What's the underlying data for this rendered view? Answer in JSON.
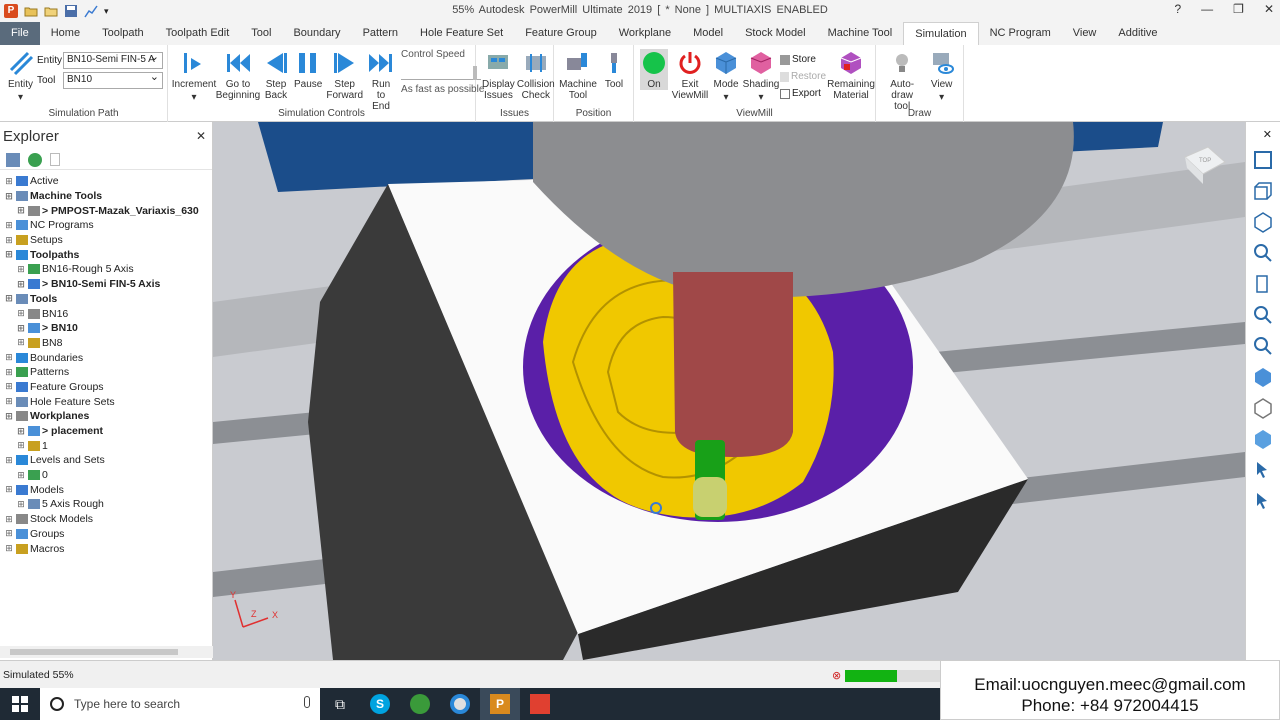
{
  "title": "55% Autodesk PowerMill Ultimate 2019    [ * None ]    MULTIAXIS ENABLED",
  "tabs": [
    "File",
    "Home",
    "Toolpath",
    "Toolpath Edit",
    "Tool",
    "Boundary",
    "Pattern",
    "Hole Feature Set",
    "Feature Group",
    "Workplane",
    "Model",
    "Stock Model",
    "Machine Tool",
    "Simulation",
    "NC Program",
    "View",
    "Additive"
  ],
  "active_tab": "Simulation",
  "ribbon": {
    "sim_path": {
      "entity_label": "Entity",
      "tool_label": "Tool",
      "entity_value": "BN10-Semi FIN-5 A",
      "tool_value": "BN10",
      "entity_btn": "Entity",
      "group": "Simulation Path"
    },
    "controls": {
      "increment": "Increment",
      "go_begin": "Go to Beginning",
      "step_back": "Step Back",
      "pause": "Pause",
      "step_fwd": "Step Forward",
      "run_end": "Run to End",
      "speed_label": "Control Speed",
      "speed_value": "As fast as possible",
      "group": "Simulation Controls"
    },
    "issues": {
      "display": "Display Issues",
      "collision": "Collision Check",
      "group": "Issues"
    },
    "position": {
      "machine_tool": "Machine Tool",
      "tool": "Tool",
      "group": "Position"
    },
    "viewmill": {
      "on": "On",
      "exit": "Exit ViewMill",
      "mode": "Mode",
      "shading": "Shading",
      "store": "Store",
      "restore": "Restore",
      "export": "Export",
      "remaining": "Remaining Material",
      "group": "ViewMill"
    },
    "draw": {
      "auto_draw": "Auto-draw tool",
      "view": "View",
      "group": "Draw"
    }
  },
  "explorer": {
    "title": "Explorer",
    "nodes": [
      {
        "label": "Active",
        "lvl": 0,
        "bold": false
      },
      {
        "label": "Machine Tools",
        "lvl": 0,
        "bold": true
      },
      {
        "label": "> PMPOST-Mazak_Variaxis_630",
        "lvl": 1,
        "bold": true
      },
      {
        "label": "NC Programs",
        "lvl": 0,
        "bold": false
      },
      {
        "label": "Setups",
        "lvl": 0,
        "bold": false
      },
      {
        "label": "Toolpaths",
        "lvl": 0,
        "bold": true
      },
      {
        "label": "BN16-Rough 5 Axis",
        "lvl": 1,
        "bold": false
      },
      {
        "label": "> BN10-Semi FIN-5 Axis",
        "lvl": 1,
        "bold": true
      },
      {
        "label": "Tools",
        "lvl": 0,
        "bold": true
      },
      {
        "label": "BN16",
        "lvl": 1,
        "bold": false
      },
      {
        "label": "> BN10",
        "lvl": 1,
        "bold": true
      },
      {
        "label": "BN8",
        "lvl": 1,
        "bold": false
      },
      {
        "label": "Boundaries",
        "lvl": 0,
        "bold": false
      },
      {
        "label": "Patterns",
        "lvl": 0,
        "bold": false
      },
      {
        "label": "Feature Groups",
        "lvl": 0,
        "bold": false
      },
      {
        "label": "Hole Feature Sets",
        "lvl": 0,
        "bold": false
      },
      {
        "label": "Workplanes",
        "lvl": 0,
        "bold": true
      },
      {
        "label": "> placement",
        "lvl": 1,
        "bold": true
      },
      {
        "label": "1",
        "lvl": 1,
        "bold": false
      },
      {
        "label": "Levels and Sets",
        "lvl": 0,
        "bold": false
      },
      {
        "label": "0",
        "lvl": 1,
        "bold": false
      },
      {
        "label": "Models",
        "lvl": 0,
        "bold": false
      },
      {
        "label": "5 Axis Rough",
        "lvl": 1,
        "bold": false
      },
      {
        "label": "Stock Models",
        "lvl": 0,
        "bold": false
      },
      {
        "label": "Groups",
        "lvl": 0,
        "bold": false
      },
      {
        "label": "Macros",
        "lvl": 0,
        "bold": false
      }
    ]
  },
  "viewport": {
    "cube_label": "TOP",
    "axis_x": "X",
    "axis_y": "Y",
    "axis_z": "Z"
  },
  "status": {
    "text": "Simulated 55%",
    "progress": 0.55
  },
  "contact": {
    "email": "Email:uocnguyen.meec@gmail.com",
    "phone": "Phone: +84 972004415"
  },
  "taskbar": {
    "search_placeholder": "Type here to search"
  }
}
